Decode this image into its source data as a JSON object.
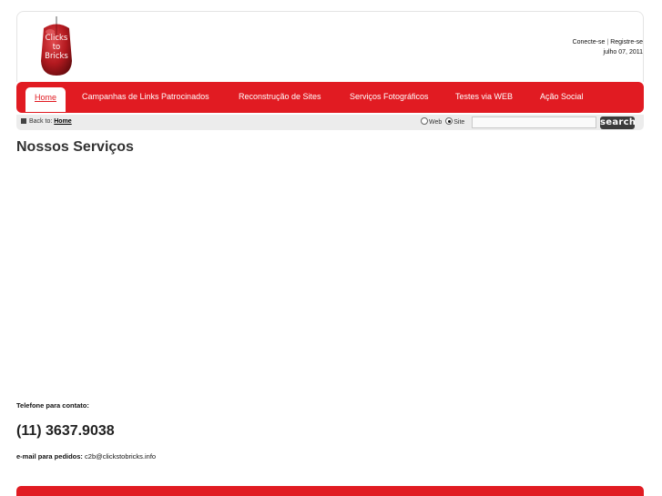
{
  "logo": {
    "lines": [
      "Clicks",
      "to",
      "Bricks"
    ],
    "colors": {
      "mouse_body": "#b3191f",
      "mouse_shadow": "#6d0d10"
    }
  },
  "header": {
    "login_label": "Conecte-se",
    "separator": "|",
    "register_label": "Registre-se",
    "date": "julho 07, 2011"
  },
  "nav": {
    "items": [
      {
        "label": "Home",
        "active": true
      },
      {
        "label": "Campanhas de Links Patrocinados",
        "active": false
      },
      {
        "label": "Reconstrução de Sites",
        "active": false
      },
      {
        "label": "Serviços Fotográficos",
        "active": false
      },
      {
        "label": "Testes via WEB",
        "active": false
      },
      {
        "label": "Ação Social",
        "active": false
      }
    ],
    "color": "#e11b22"
  },
  "breadcrumb": {
    "prefix": "Back to:",
    "link": "Home"
  },
  "search": {
    "option_web": "Web",
    "option_site": "Site",
    "selected": "Site",
    "value": "",
    "button_label": "search"
  },
  "main": {
    "title": "Nossos Serviços"
  },
  "contact": {
    "phone_label": "Telefone para contato:",
    "phone": "(11) 3637.9038",
    "email_label": "e-mail para pedidos:",
    "email": "c2b@clickstobricks.info"
  }
}
